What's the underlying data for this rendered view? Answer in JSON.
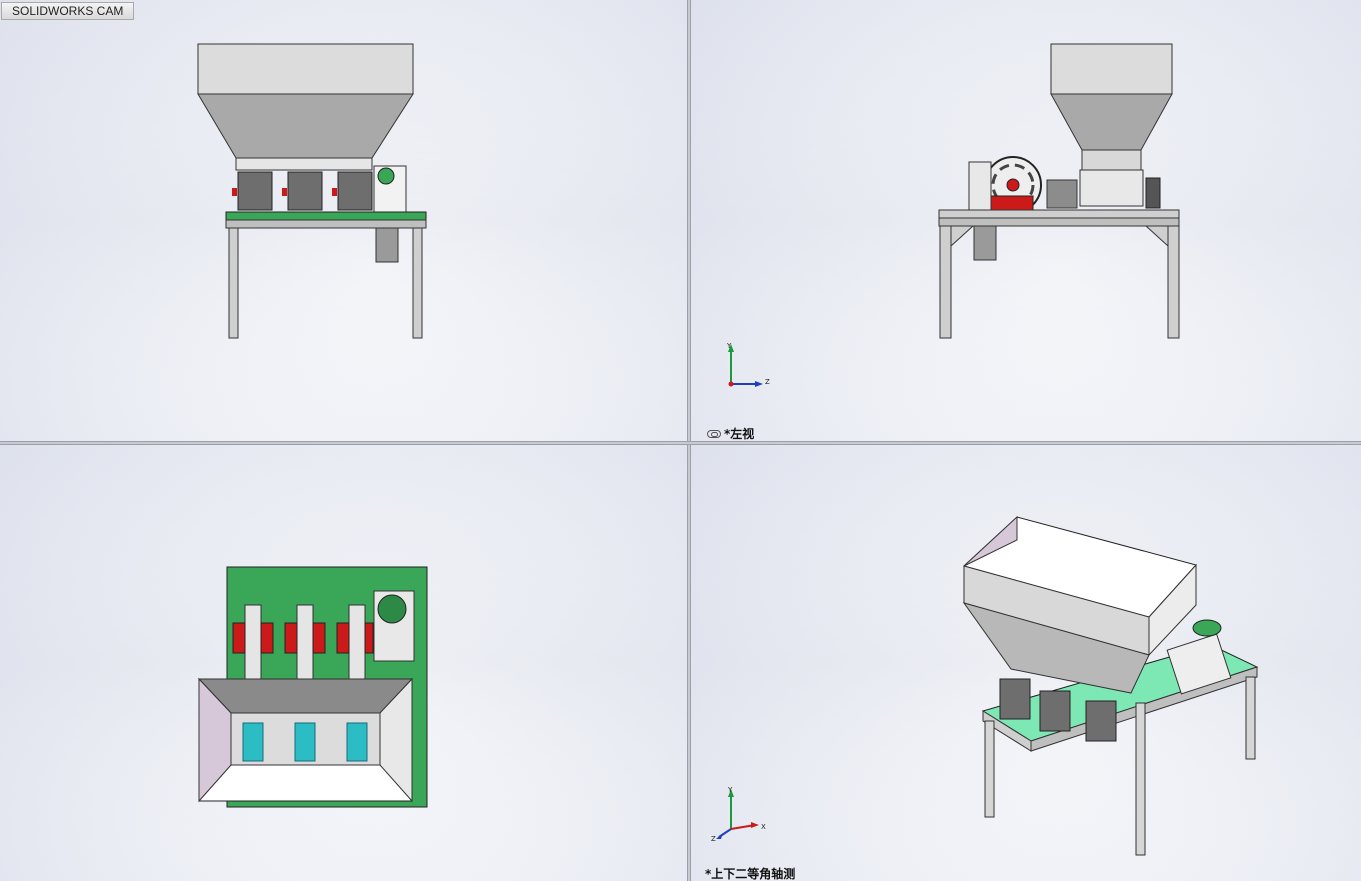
{
  "tab": {
    "label": "SOLIDWORKS CAM"
  },
  "viewports": {
    "top_left": {
      "label": ""
    },
    "top_right": {
      "label": "*左视"
    },
    "bottom_left": {
      "label": ""
    },
    "bottom_right": {
      "label": "*上下二等角轴测"
    }
  },
  "triad": {
    "x": "X",
    "y": "Y",
    "z": "Z"
  },
  "toolbar": {
    "items": [
      "zoom-to-fit-icon",
      "zoom-to-area-icon",
      "previous-view-icon",
      "section-view-icon",
      "view-orientation-icon",
      "display-style-icon",
      "hide-show-items-icon",
      "edit-appearance-icon",
      "apply-scene-icon",
      "view-settings-icon"
    ]
  },
  "colors": {
    "green_plate": "#3aa657",
    "teal_plate": "#7de8b4",
    "hopper": "#d2d2d2",
    "accent_red": "#cc1a1a"
  }
}
